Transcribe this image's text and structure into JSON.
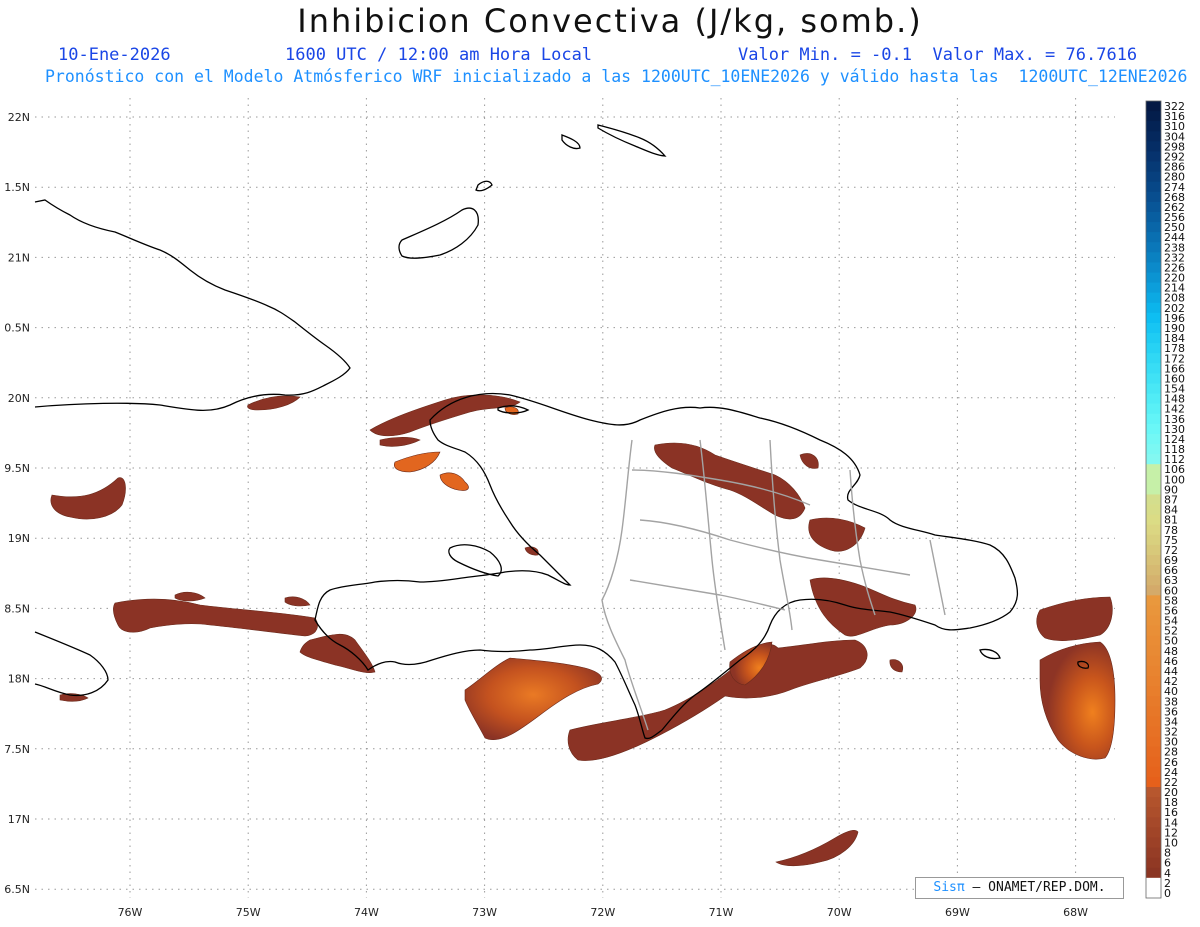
{
  "header": {
    "title": "Inhibicion Convectiva (J/kg, somb.)",
    "date": "10-Ene-2026",
    "time": "1600 UTC / 12:00 am Hora Local",
    "minmax": "Valor Min. = -0.1  Valor Max. = 76.7616",
    "forecast": "Pronóstico con el Modelo Atmósferico WRF inicializado a las 1200UTC_10ENE2026 y válido hasta las  1200UTC_12ENE2026"
  },
  "map": {
    "lat_labels": [
      "22N",
      "1.5N",
      "21N",
      "0.5N",
      "20N",
      "9.5N",
      "19N",
      "8.5N",
      "18N",
      "7.5N",
      "17N",
      "6.5N"
    ],
    "lon_labels": [
      "76W",
      "75W",
      "74W",
      "73W",
      "72W",
      "71W",
      "70W",
      "69W",
      "68W"
    ]
  },
  "colorbar": {
    "labels": [
      "322",
      "316",
      "310",
      "304",
      "298",
      "292",
      "286",
      "280",
      "274",
      "268",
      "262",
      "256",
      "250",
      "244",
      "238",
      "232",
      "226",
      "220",
      "214",
      "208",
      "202",
      "196",
      "190",
      "184",
      "178",
      "172",
      "166",
      "160",
      "154",
      "148",
      "142",
      "136",
      "130",
      "124",
      "118",
      "112",
      "106",
      "100",
      "90",
      "87",
      "84",
      "81",
      "78",
      "75",
      "72",
      "69",
      "66",
      "63",
      "60",
      "58",
      "56",
      "54",
      "52",
      "50",
      "48",
      "46",
      "44",
      "42",
      "40",
      "38",
      "36",
      "34",
      "32",
      "30",
      "28",
      "26",
      "24",
      "22",
      "20",
      "18",
      "16",
      "14",
      "12",
      "10",
      "8",
      "6",
      "4",
      "2",
      "0"
    ]
  },
  "credit": {
    "brand": "Sisπ",
    "org": " – ONAMET/REP.DOM."
  }
}
